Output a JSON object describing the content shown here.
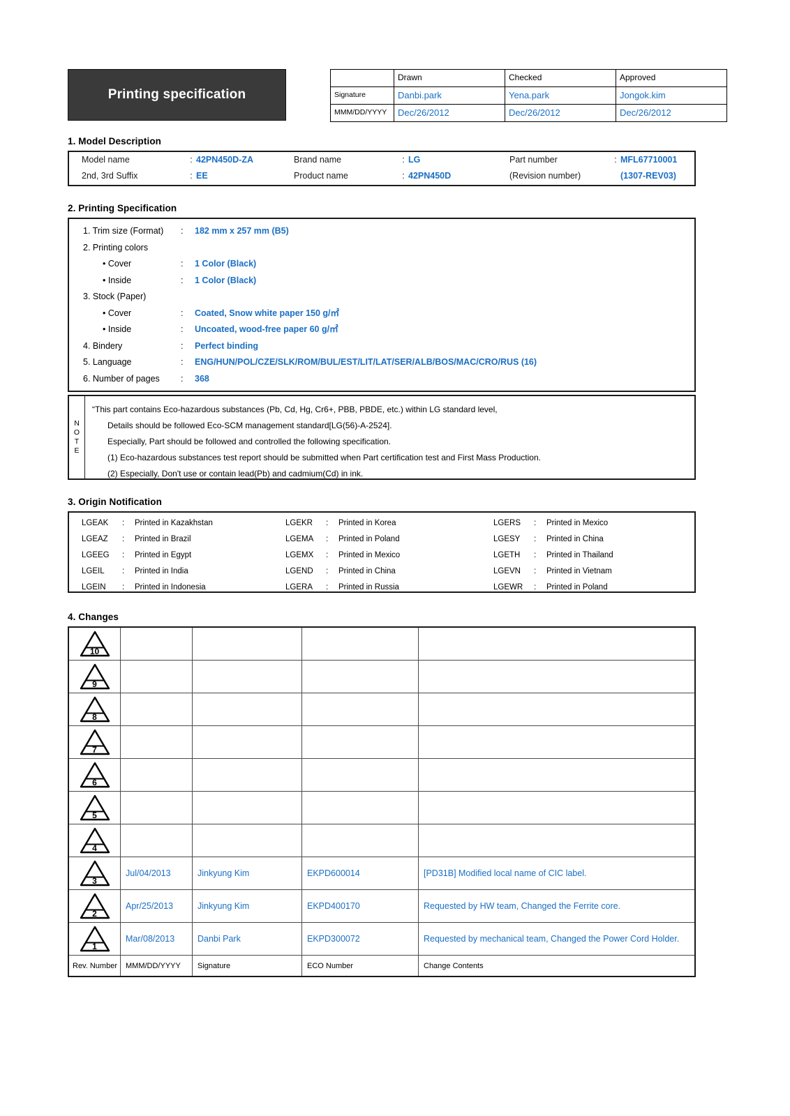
{
  "header": {
    "title": "Printing specification",
    "approval": {
      "columns": [
        "Drawn",
        "Checked",
        "Approved"
      ],
      "row_labels": [
        "Signature",
        "MMM/DD/YYYY"
      ],
      "signatures": [
        "Danbi.park",
        "Yena.park",
        "Jongok.kim"
      ],
      "dates": [
        "Dec/26/2012",
        "Dec/26/2012",
        "Dec/26/2012"
      ]
    }
  },
  "section1": {
    "heading": "1. Model Description",
    "colon": ":",
    "rows": [
      {
        "l1": "Model name",
        "v1": "42PN450D-ZA",
        "l2": "Brand name",
        "v2": "LG",
        "l3": "Part number",
        "v3": "MFL67710001",
        "c3": ":"
      },
      {
        "l1": "2nd, 3rd Suffix",
        "v1": "EE",
        "l2": "Product name",
        "v2": "42PN450D",
        "l3": "(Revision number)",
        "v3": "(1307-REV03)",
        "c3": ""
      }
    ]
  },
  "section2": {
    "heading": "2. Printing Specification",
    "colon": ":",
    "items": [
      {
        "key": "1. Trim size (Format)",
        "colon": ":",
        "value": "182 mm x 257 mm (B5)",
        "indent": false
      },
      {
        "key": "2. Printing colors",
        "colon": "",
        "value": "",
        "indent": false
      },
      {
        "key": "• Cover",
        "colon": ":",
        "value": "1 Color (Black)",
        "indent": true
      },
      {
        "key": "• Inside",
        "colon": ":",
        "value": "1 Color (Black)",
        "indent": true
      },
      {
        "key": "3. Stock (Paper)",
        "colon": "",
        "value": "",
        "indent": false
      },
      {
        "key": "• Cover",
        "colon": ":",
        "value": "Coated, Snow white paper 150 g/㎡",
        "indent": true
      },
      {
        "key": "• Inside",
        "colon": ":",
        "value": "Uncoated, wood-free paper 60 g/㎡",
        "indent": true
      },
      {
        "key": "4. Bindery",
        "colon": ":",
        "value": "Perfect binding",
        "indent": false
      },
      {
        "key": "5. Language",
        "colon": ":",
        "value": "ENG/HUN/POL/CZE/SLK/ROM/BUL/EST/LIT/LAT/SER/ALB/BOS/MAC/CRO/RUS (16)",
        "indent": false
      },
      {
        "key": "6. Number of pages",
        "colon": ":",
        "value": "368",
        "indent": false
      }
    ]
  },
  "note": {
    "label_letters": [
      "N",
      "O",
      "T",
      "E"
    ],
    "lines": [
      {
        "text": "“This part contains Eco-hazardous substances (Pb, Cd, Hg, Cr6+, PBB, PBDE, etc.) within LG standard level,",
        "indent": false
      },
      {
        "text": "Details should be followed Eco-SCM management standard[LG(56)-A-2524].",
        "indent": true
      },
      {
        "text": "Especially, Part should be followed and controlled the following specification.",
        "indent": true
      },
      {
        "text": "(1) Eco-hazardous substances test report should be submitted when Part certification test and First Mass Production.",
        "indent": true
      },
      {
        "text": "(2) Especially, Don't use or contain lead(Pb) and cadmium(Cd) in ink.",
        "indent": true
      }
    ]
  },
  "section3": {
    "heading": "3. Origin Notification",
    "colon": ":",
    "rows": [
      [
        {
          "code": "LGEAK",
          "country": "Printed in Kazakhstan"
        },
        {
          "code": "LGEKR",
          "country": "Printed in Korea"
        },
        {
          "code": "LGERS",
          "country": "Printed in Mexico"
        }
      ],
      [
        {
          "code": "LGEAZ",
          "country": "Printed in Brazil"
        },
        {
          "code": "LGEMA",
          "country": "Printed in Poland"
        },
        {
          "code": "LGESY",
          "country": "Printed in China"
        }
      ],
      [
        {
          "code": "LGEEG",
          "country": "Printed in Egypt"
        },
        {
          "code": "LGEMX",
          "country": "Printed in Mexico"
        },
        {
          "code": "LGETH",
          "country": "Printed in Thailand"
        }
      ],
      [
        {
          "code": "LGEIL",
          "country": "Printed in India"
        },
        {
          "code": "LGEND",
          "country": "Printed in China"
        },
        {
          "code": "LGEVN",
          "country": "Printed in Vietnam"
        }
      ],
      [
        {
          "code": "LGEIN",
          "country": "Printed in Indonesia"
        },
        {
          "code": "LGERA",
          "country": "Printed in Russia"
        },
        {
          "code": "LGEWR",
          "country": "Printed in Poland"
        }
      ]
    ]
  },
  "section4": {
    "heading": "4. Changes",
    "rows": [
      {
        "rev": "10",
        "date": "",
        "signature": "",
        "eco": "",
        "contents": ""
      },
      {
        "rev": "9",
        "date": "",
        "signature": "",
        "eco": "",
        "contents": ""
      },
      {
        "rev": "8",
        "date": "",
        "signature": "",
        "eco": "",
        "contents": ""
      },
      {
        "rev": "7",
        "date": "",
        "signature": "",
        "eco": "",
        "contents": ""
      },
      {
        "rev": "6",
        "date": "",
        "signature": "",
        "eco": "",
        "contents": ""
      },
      {
        "rev": "5",
        "date": "",
        "signature": "",
        "eco": "",
        "contents": ""
      },
      {
        "rev": "4",
        "date": "",
        "signature": "",
        "eco": "",
        "contents": ""
      },
      {
        "rev": "3",
        "date": "Jul/04/2013",
        "signature": "Jinkyung Kim",
        "eco": "EKPD600014",
        "contents": "[PD31B] Modified local name of CIC label."
      },
      {
        "rev": "2",
        "date": "Apr/25/2013",
        "signature": "Jinkyung Kim",
        "eco": "EKPD400170",
        "contents": "Requested by HW team, Changed the Ferrite core."
      },
      {
        "rev": "1",
        "date": "Mar/08/2013",
        "signature": "Danbi Park",
        "eco": "EKPD300072",
        "contents": "Requested by mechanical team, Changed the Power Cord Holder."
      }
    ],
    "footer": {
      "rev": "Rev. Number",
      "date": "MMM/DD/YYYY",
      "signature": "Signature",
      "eco": "ECO Number",
      "contents": "Change Contents"
    }
  },
  "colors": {
    "accent_blue": "#1a6fc4",
    "title_bg": "#3a3a3a",
    "border": "#1a1a1a"
  }
}
